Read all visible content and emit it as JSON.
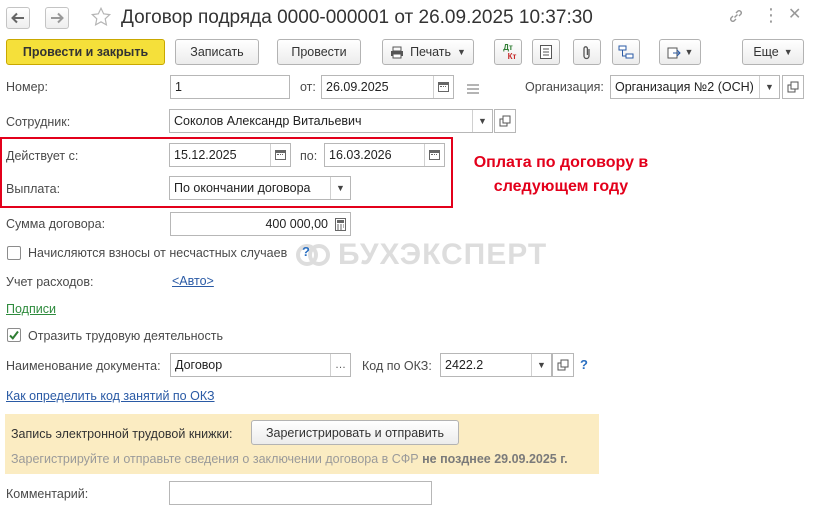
{
  "window": {
    "title": "Договор подряда 0000-000001 от 26.09.2025 10:37:30"
  },
  "toolbar": {
    "post_close": "Провести и закрыть",
    "save": "Записать",
    "post": "Провести",
    "print": "Печать",
    "dt_kt": "Дт Кт",
    "more": "Еще"
  },
  "form": {
    "number_label": "Номер:",
    "number_value": "1",
    "from_label": "от:",
    "date_value": "26.09.2025",
    "org_label": "Организация:",
    "org_value": "Организация №2 (ОСН)",
    "employee_label": "Сотрудник:",
    "employee_value": "Соколов Александр Витальевич",
    "valid_from_label": "Действует с:",
    "valid_from_value": "15.12.2025",
    "valid_to_label": "по:",
    "valid_to_value": "16.03.2026",
    "payment_label": "Выплата:",
    "payment_value": "По окончании договора",
    "sum_label": "Сумма договора:",
    "sum_value": "400 000,00",
    "accident_label": "Начисляются взносы от несчастных случаев",
    "accident_checked": false,
    "expense_label": "Учет расходов:",
    "expense_value": "<Авто>",
    "signatures_link": "Подписи",
    "reflect_label": "Отразить трудовую деятельность",
    "reflect_checked": true,
    "docname_label": "Наименование документа:",
    "docname_value": "Договор",
    "okz_label": "Код по ОКЗ:",
    "okz_value": "2422.2",
    "okz_link": "Как определить код занятий по ОКЗ",
    "comment_label": "Комментарий:",
    "comment_value": ""
  },
  "etk": {
    "label": "Запись электронной трудовой книжки:",
    "button": "Зарегистрировать и отправить",
    "hint": "Зарегистрируйте и отправьте сведения о заключении договора в СФР",
    "hint_bold": "не позднее 29.09.2025 г."
  },
  "annotation": {
    "line1": "Оплата по договору в",
    "line2": "следующем году",
    "color": "#e3001b"
  },
  "watermark": "БУХЭКСПЕРТ",
  "colors": {
    "primary_button": "#f5e03a",
    "notice_bg": "#fbecc2",
    "link": "#2a5aa5",
    "green_link": "#2e8b3d",
    "red": "#e3001b"
  }
}
